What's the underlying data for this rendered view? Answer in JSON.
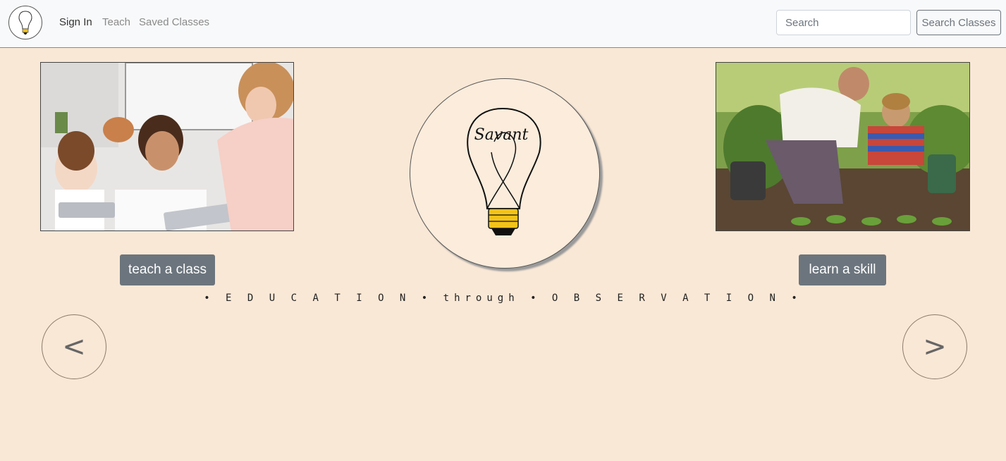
{
  "nav": {
    "logo_icon": "lightbulb-logo-icon",
    "links": [
      {
        "label": "Sign In",
        "active": true
      },
      {
        "label": "Teach",
        "active": false
      },
      {
        "label": "Saved Classes",
        "active": false
      }
    ],
    "search": {
      "placeholder": "Search",
      "value": ""
    },
    "search_button": "Search Classes"
  },
  "main": {
    "left": {
      "image": "teacher-with-students-tablets-photo",
      "button": "teach a class"
    },
    "right": {
      "image": "father-son-gardening-photo",
      "button": "learn a skill"
    },
    "center_logo": {
      "icon": "lightbulb-logo-icon",
      "signature": "Savant"
    },
    "tagline": "• E D U C A T I O N • through • O B S E R V A T I O N •",
    "prev": "<",
    "next": ">"
  },
  "colors": {
    "page_bg": "#fae8d6",
    "button_bg": "#6c757d",
    "bulb_base": "#f2c31a"
  }
}
